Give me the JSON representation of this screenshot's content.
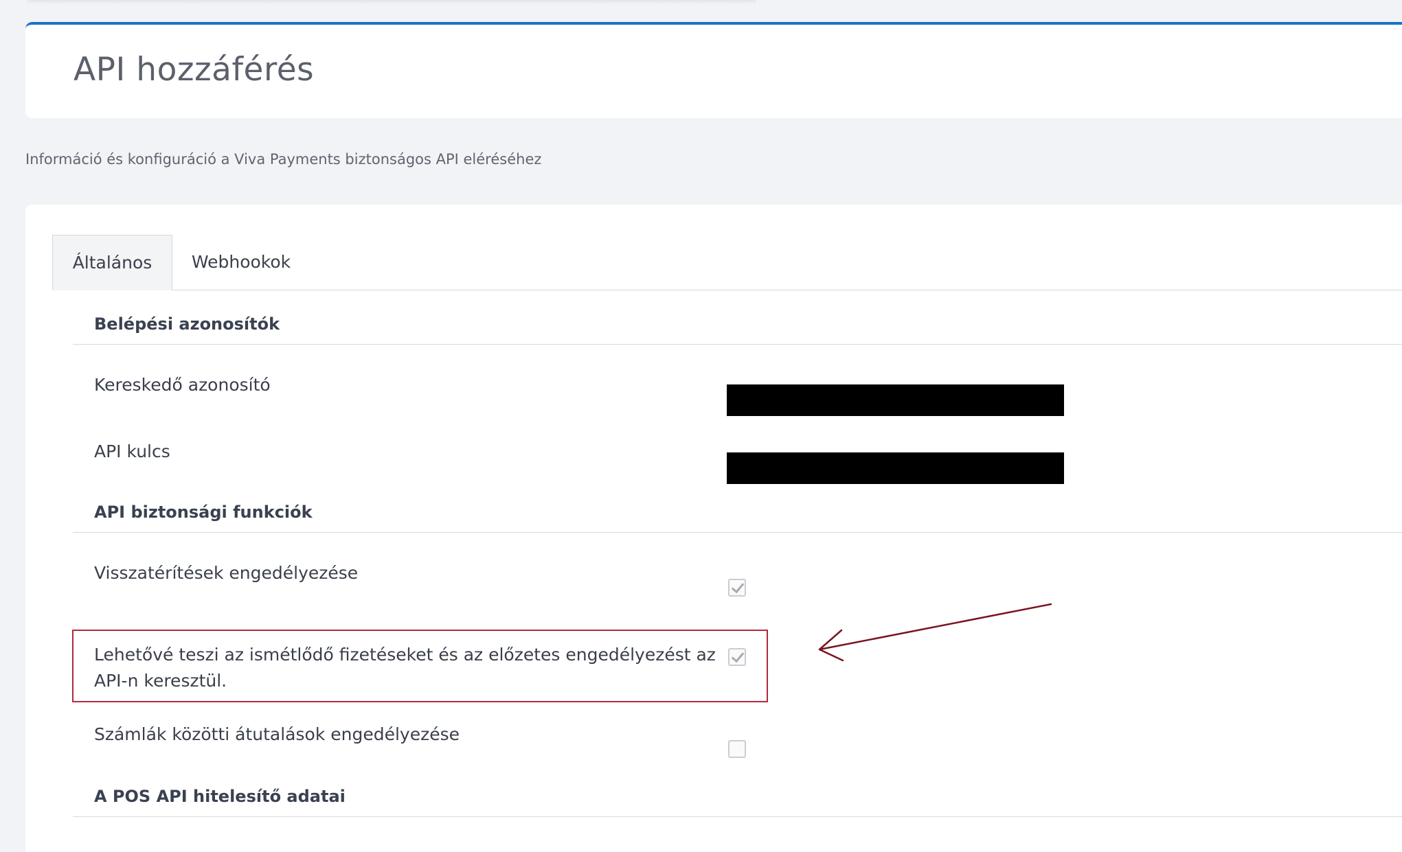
{
  "header": {
    "title": "API hozzáférés"
  },
  "subtitle": "Információ és konfiguráció a Viva Payments biztonságos API eléréséhez",
  "tabs": [
    {
      "label": "Általános",
      "active": true
    },
    {
      "label": "Webhookok",
      "active": false
    }
  ],
  "sections": {
    "credentials": {
      "title": "Belépési azonosítók",
      "merchant_id_label": "Kereskedő azonosító",
      "api_key_label": "API kulcs"
    },
    "security": {
      "title": "API biztonsági funkciók",
      "refunds_label": "Visszatérítések engedélyezése",
      "refunds_checked": true,
      "recurring_label_line1": "Lehetővé teszi az ismétlődő fizetéseket és az előzetes engedélyezést az",
      "recurring_label_line2": "API-n keresztül.",
      "recurring_checked": true,
      "transfers_label": "Számlák közötti átutalások engedélyezése",
      "transfers_checked": false
    },
    "pos": {
      "title": "A POS API hitelesítő adatai"
    }
  },
  "colors": {
    "accent": "#1a73c8",
    "highlight": "#b3283b",
    "arrow": "#7a1420"
  }
}
